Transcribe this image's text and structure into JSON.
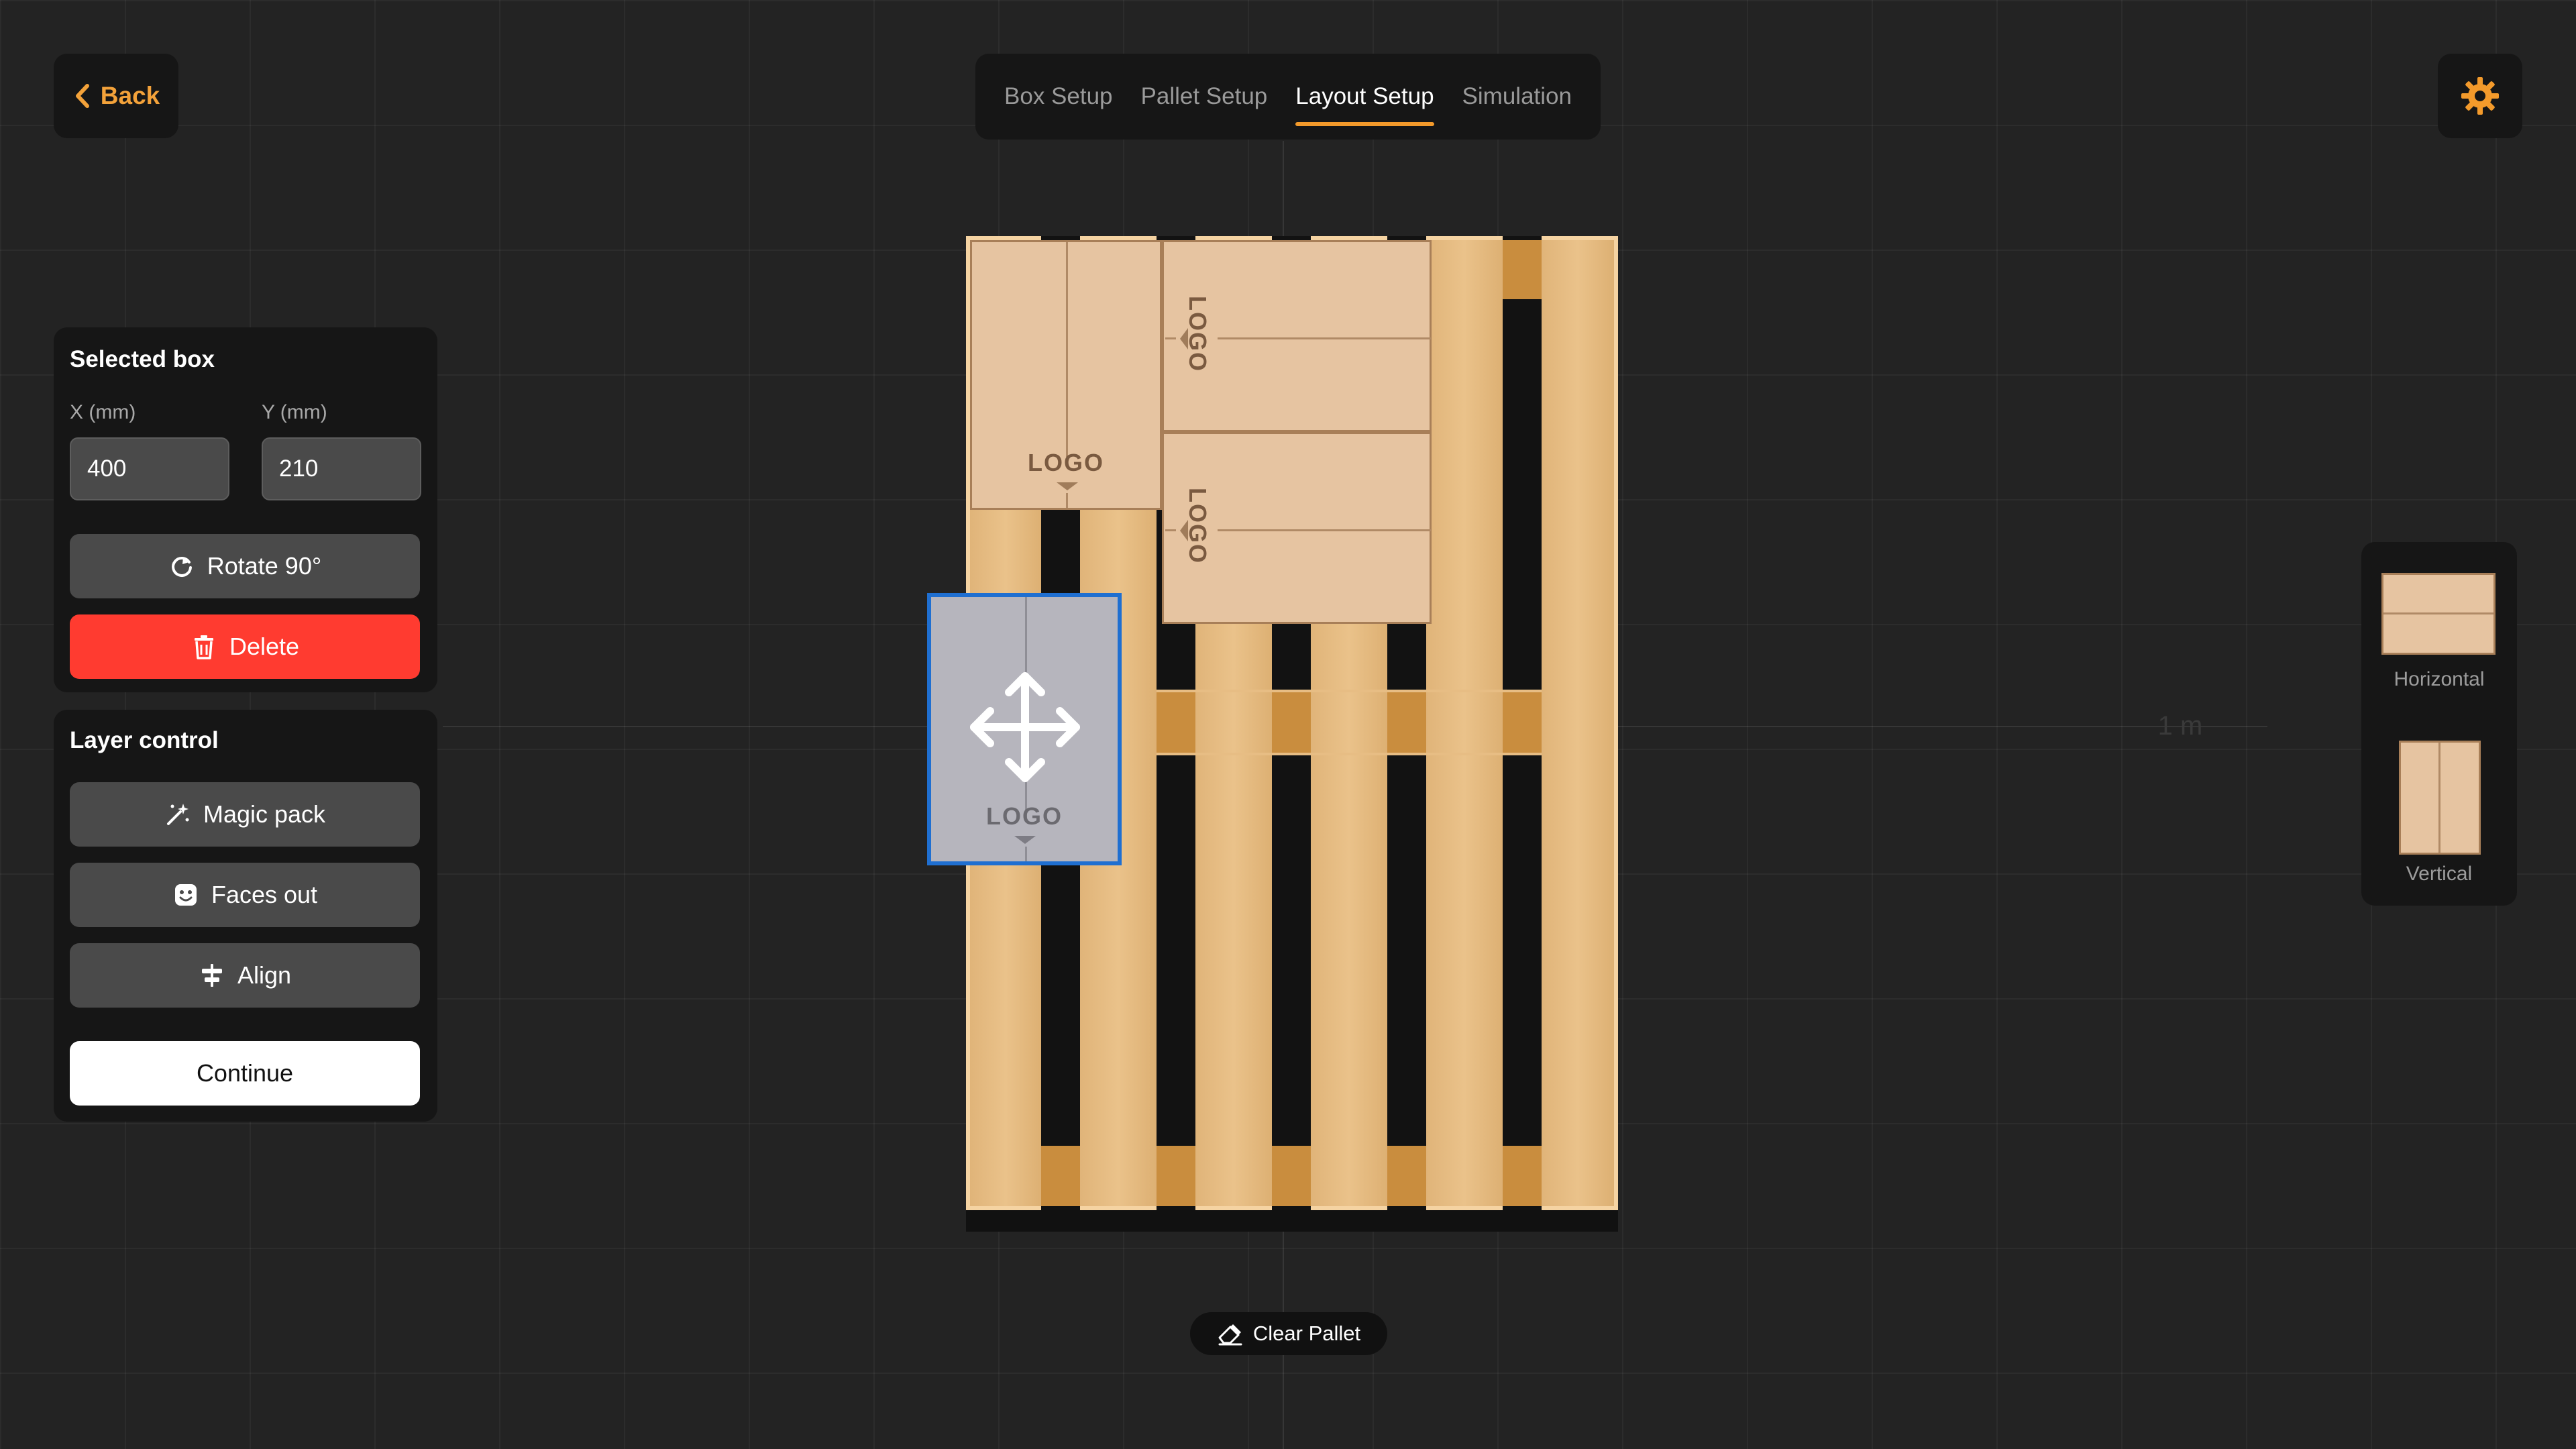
{
  "nav": {
    "back_label": "Back",
    "tabs": [
      "Box Setup",
      "Pallet Setup",
      "Layout Setup",
      "Simulation"
    ],
    "active_tab": "Layout Setup",
    "accent_color": "#f39a2b"
  },
  "selected_box": {
    "title": "Selected box",
    "x_label": "X (mm)",
    "y_label": "Y (mm)",
    "x_value": "400",
    "y_value": "210",
    "rotate_label": "Rotate 90°",
    "delete_label": "Delete"
  },
  "layer_control": {
    "title": "Layer control",
    "magic_pack_label": "Magic pack",
    "faces_out_label": "Faces out",
    "align_label": "Align",
    "continue_label": "Continue"
  },
  "canvas": {
    "box_logo": "LOGO",
    "scale_label": "1 m",
    "clear_label": "Clear Pallet"
  },
  "orientation": {
    "horizontal_label": "Horizontal",
    "vertical_label": "Vertical"
  },
  "icons": {
    "back": "chevron-left-icon",
    "settings": "gear-icon",
    "rotate": "rotate-icon",
    "delete": "trash-icon",
    "magic": "magic-wand-icon",
    "faces": "smiley-face-icon",
    "align": "align-icon",
    "move": "move-arrows-icon",
    "eraser": "eraser-icon"
  }
}
